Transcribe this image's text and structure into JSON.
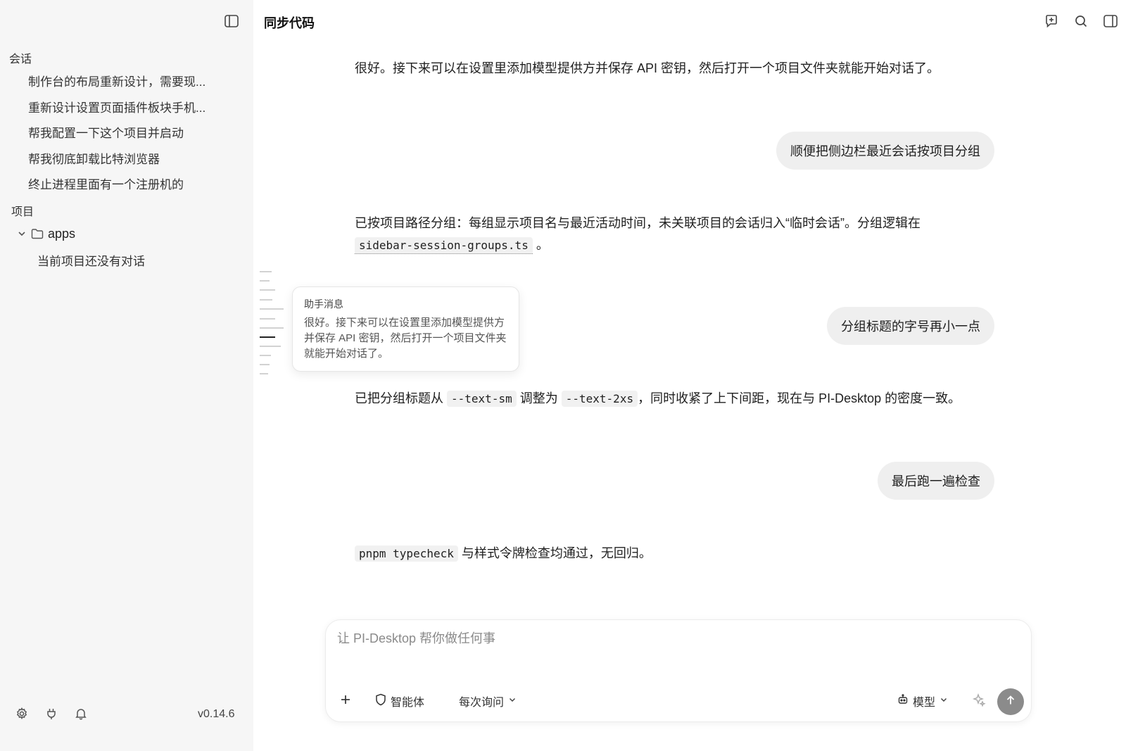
{
  "sidebar": {
    "sessions_label": "会话",
    "sessions": [
      {
        "label": "制作台的布局重新设计，需要现..."
      },
      {
        "label": "重新设计设置页面插件板块手机..."
      },
      {
        "label": "帮我配置一下这个项目并启动"
      },
      {
        "label": "帮我彻底卸载比特浏览器"
      },
      {
        "label": "终止进程里面有一个注册机的"
      }
    ],
    "projects_label": "项目",
    "project": {
      "name": "apps",
      "empty_text": "当前项目还没有对话"
    },
    "version": "v0.14.6"
  },
  "header": {
    "title": "同步代码"
  },
  "messages": {
    "m1": "很好。接下来可以在设置里添加模型提供方并保存 API 密钥，然后打开一个项目文件夹就能开始对话了。",
    "u1": "顺便把侧边栏最近会话按项目分组",
    "m2_text": "已按项目路径分组：每组显示项目名与最近活动时间，未关联项目的会话归入“临时会话”。分组逻辑在",
    "m2_code": "sidebar-session-groups.ts",
    "m2_end": "。",
    "u2": "分组标题的字号再小一点",
    "m3_a": "已把分组标题从",
    "m3_code1": "--text-sm",
    "m3_b": "调整为",
    "m3_code2": "--text-2xs",
    "m3_c": "，同时收紧了上下间距，现在与 PI-Desktop 的密度一致。",
    "u3": "最后跑一遍检查",
    "m4_code": "pnpm typecheck",
    "m4_text": "与样式令牌检查均通过，无回归。"
  },
  "tooltip": {
    "title": "助手消息",
    "body": "很好。接下来可以在设置里添加模型提供方并保存 API 密钥，然后打开一个项目文件夹就能开始对话了。"
  },
  "composer": {
    "placeholder": "让 PI-Desktop 帮你做任何事",
    "agent_label": "智能体",
    "approval_label": "每次询问",
    "model_label": "模型"
  },
  "icons": {
    "sidebar_toggle": "sidebar-toggle-icon",
    "new_chat": "new-chat-icon",
    "search": "search-icon",
    "right_panel": "right-panel-icon",
    "settings": "gear-icon",
    "plugin": "plug-icon",
    "notifications": "bell-icon",
    "add": "plus-icon",
    "shield": "shield-icon",
    "robot": "robot-icon",
    "sparkle": "sparkle-icon",
    "send": "arrow-up-icon"
  },
  "colors": {
    "sidebar_bg": "#f6f6f6",
    "bubble_bg": "#efefef",
    "send_bg": "#8b8b8b"
  }
}
